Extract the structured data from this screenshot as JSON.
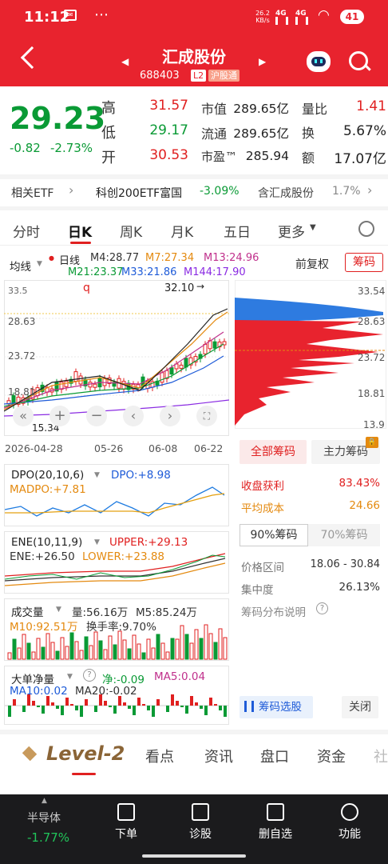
{
  "status": {
    "time": "11:12",
    "net_speed": "26.2 KB/s",
    "signal1": "4G",
    "signal2": "4G",
    "battery": "41"
  },
  "header": {
    "name": "汇成股份",
    "code": "688403",
    "badge_l2": "L2",
    "badge_hgt": "沪股通"
  },
  "quote": {
    "price": "29.23",
    "change": "-0.82",
    "change_pct": "-2.73%",
    "high_label": "高",
    "high": "31.57",
    "low_label": "低",
    "low": "29.17",
    "open_label": "开",
    "open": "30.53",
    "mcap_label": "市值",
    "mcap": "289.65亿",
    "float_label": "流通",
    "float": "289.65亿",
    "pe_label": "市盈™",
    "pe": "285.94",
    "vr_label": "量比",
    "vr": "1.41",
    "turnover_label": "换",
    "turnover": "5.67%",
    "amount_label": "额",
    "amount": "17.07亿"
  },
  "etf": {
    "label": "相关ETF",
    "name": "科创200ETF富国",
    "pct": "-3.09%",
    "hold_label": "含汇成股份",
    "hold_pct": "1.7%"
  },
  "tabs": [
    "分时",
    "日K",
    "周K",
    "月K",
    "五日",
    "更多"
  ],
  "kline": {
    "selector": "均线",
    "series_label": "日线",
    "ma4": "M4:28.77",
    "ma7": "M7:27.34",
    "ma13": "M13:24.96",
    "ma21": "M21:23.37",
    "ma33": "M33:21.86",
    "ma144": "M144:17.90",
    "fq": "前复权",
    "chips_btn": "筹码",
    "high_mark": "32.10",
    "low_mark": "15.34",
    "left_top": "33.5",
    "y_ticks": [
      "28.63",
      "23.72",
      "18.81"
    ],
    "dates": [
      "2026-04-28",
      "05-26",
      "06-08",
      "06-22"
    ],
    "tag_q": "q"
  },
  "chip_axis": {
    "ticks": [
      "33.54",
      "28.63",
      "23.72",
      "18.81",
      "13.9"
    ]
  },
  "dpo": {
    "title": "DPO(20,10,6)",
    "dpo": "DPO:+8.98",
    "madpo": "MADPO:+7.81"
  },
  "ene": {
    "title": "ENE(10,11,9)",
    "upper": "UPPER:+29.13",
    "ene": "ENE:+26.50",
    "lower": "LOWER:+23.88"
  },
  "vol": {
    "title": "成交量",
    "vol": "量:56.16万",
    "m5": "M5:85.24万",
    "m10": "M10:92.51万",
    "turnover": "换手率:9.70%"
  },
  "bigorder": {
    "title": "大单净量",
    "net": "净:-0.09",
    "ma5": "MA5:0.04",
    "ma10": "MA10:0.02",
    "ma20": "MA20:-0.02"
  },
  "chips_panel": {
    "tab_all": "全部筹码",
    "tab_main": "主力筹码",
    "profit_label": "收盘获利",
    "profit": "83.43%",
    "cost_label": "平均成本",
    "cost": "24.66",
    "tab90": "90%筹码",
    "tab70": "70%筹码",
    "range_label": "价格区间",
    "range": "18.06 - 30.84",
    "conc_label": "集中度",
    "conc": "26.13%",
    "desc": "筹码分布说明",
    "select_btn": "筹码选股",
    "close_btn": "关闭"
  },
  "bottom_tabs": [
    "Level-2",
    "看点",
    "资讯",
    "盘口",
    "资金",
    "社"
  ],
  "bottom_bar": {
    "sector": "半导体",
    "sector_pct": "-1.77%",
    "items": [
      "下单",
      "诊股",
      "删自选",
      "功能"
    ]
  },
  "colors": {
    "red": "#e02020",
    "green": "#0a9a35",
    "header": "#e8232e"
  }
}
